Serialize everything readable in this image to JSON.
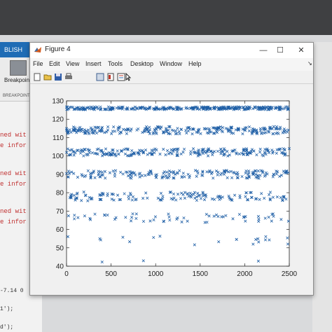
{
  "background": {
    "ribbon_tab": "BLISH",
    "breakpoints_label": "Breakpoin",
    "breakpoints_section": "BREAKPOINT",
    "error_lines": [
      "ned wit",
      "e infor",
      "ned wit",
      "e infor",
      "ned wit",
      "e infor"
    ],
    "code_lines": [
      "-7.14 0",
      "1');",
      "d');"
    ]
  },
  "figure": {
    "title": "Figure 4",
    "window_controls": {
      "minimize": "—",
      "maximize": "☐",
      "close": "✕"
    },
    "menus": [
      "File",
      "Edit",
      "View",
      "Insert",
      "Tools",
      "Desktop",
      "Window",
      "Help"
    ],
    "toolbar_icons": [
      "new-figure-icon",
      "open-file-icon",
      "save-icon",
      "print-icon",
      "link-plot-icon",
      "insert-colorbar-icon",
      "insert-legend-icon",
      "edit-plot-icon"
    ]
  },
  "colors": {
    "marker": "#1f5fa6",
    "axes": "#222222",
    "plot_bg": "#ffffff"
  },
  "chart_data": {
    "type": "scatter",
    "marker": "x",
    "xlim": [
      0,
      2500
    ],
    "ylim": [
      40,
      130
    ],
    "xticks": [
      0,
      500,
      1000,
      1500,
      2000,
      2500
    ],
    "yticks": [
      40,
      50,
      60,
      70,
      80,
      90,
      100,
      110,
      120,
      130
    ],
    "bands": [
      {
        "y": 126,
        "spread": 0.8,
        "count": 320
      },
      {
        "y": 114,
        "spread": 2.0,
        "count": 260
      },
      {
        "y": 102,
        "spread": 2.0,
        "count": 230
      },
      {
        "y": 90,
        "spread": 2.2,
        "count": 180
      },
      {
        "y": 78,
        "spread": 2.4,
        "count": 140
      },
      {
        "y": 66,
        "spread": 2.5,
        "count": 60
      },
      {
        "y": 54,
        "spread": 2.5,
        "count": 20
      },
      {
        "y": 42,
        "spread": 1.5,
        "count": 3
      }
    ]
  }
}
